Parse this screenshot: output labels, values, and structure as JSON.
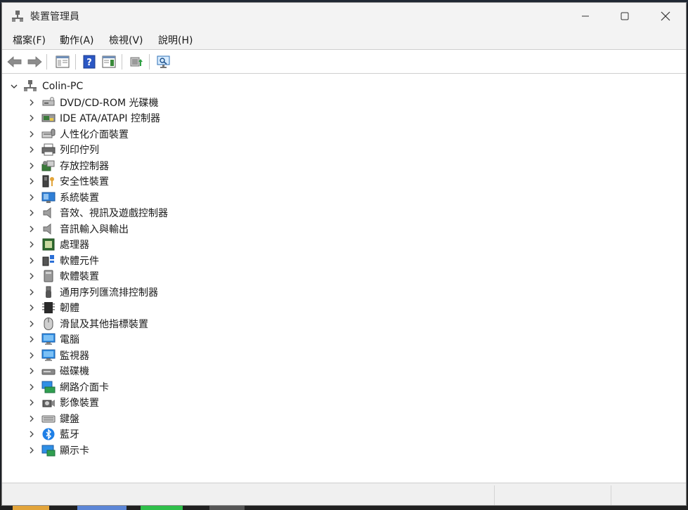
{
  "window": {
    "title": "裝置管理員",
    "minimize_icon": "minimize-icon",
    "maximize_icon": "maximize-icon",
    "close_icon": "close-icon"
  },
  "menu": [
    {
      "label": "檔案(F)"
    },
    {
      "label": "動作(A)"
    },
    {
      "label": "檢視(V)"
    },
    {
      "label": "說明(H)"
    }
  ],
  "toolbar": [
    {
      "icon": "back-arrow-icon"
    },
    {
      "icon": "forward-arrow-icon"
    },
    {
      "icon": "properties-pane-icon"
    },
    {
      "icon": "help-icon"
    },
    {
      "icon": "console-view-icon"
    },
    {
      "icon": "update-driver-icon"
    },
    {
      "icon": "scan-hardware-icon"
    }
  ],
  "tree": {
    "root": {
      "label": "Colin-PC",
      "icon": "computer-network-icon",
      "expanded": true
    },
    "items": [
      {
        "label": "DVD/CD-ROM 光碟機",
        "icon": "dvd-drive-icon"
      },
      {
        "label": "IDE ATA/ATAPI 控制器",
        "icon": "ide-controller-icon"
      },
      {
        "label": "人性化介面裝置",
        "icon": "hid-icon"
      },
      {
        "label": "列印佇列",
        "icon": "printer-icon"
      },
      {
        "label": "存放控制器",
        "icon": "storage-controller-icon"
      },
      {
        "label": "安全性裝置",
        "icon": "security-key-icon"
      },
      {
        "label": "系統裝置",
        "icon": "system-device-icon"
      },
      {
        "label": "音效、視訊及遊戲控制器",
        "icon": "speaker-icon"
      },
      {
        "label": "音訊輸入與輸出",
        "icon": "speaker-icon"
      },
      {
        "label": "處理器",
        "icon": "processor-icon"
      },
      {
        "label": "軟體元件",
        "icon": "software-component-icon"
      },
      {
        "label": "軟體裝置",
        "icon": "software-device-icon"
      },
      {
        "label": "通用序列匯流排控制器",
        "icon": "usb-icon"
      },
      {
        "label": "韌體",
        "icon": "firmware-chip-icon"
      },
      {
        "label": "滑鼠及其他指標裝置",
        "icon": "mouse-icon"
      },
      {
        "label": "電腦",
        "icon": "monitor-icon"
      },
      {
        "label": "監視器",
        "icon": "monitor-icon"
      },
      {
        "label": "磁碟機",
        "icon": "disk-drive-icon"
      },
      {
        "label": "網路介面卡",
        "icon": "network-adapter-icon"
      },
      {
        "label": "影像裝置",
        "icon": "camera-icon"
      },
      {
        "label": "鍵盤",
        "icon": "keyboard-icon"
      },
      {
        "label": "藍牙",
        "icon": "bluetooth-icon"
      },
      {
        "label": "顯示卡",
        "icon": "display-adapter-icon"
      }
    ]
  },
  "colors": {
    "titlebar": "#f3f3f3",
    "accent": "#2b6fd6",
    "statusbar": "#f0f0f0"
  }
}
